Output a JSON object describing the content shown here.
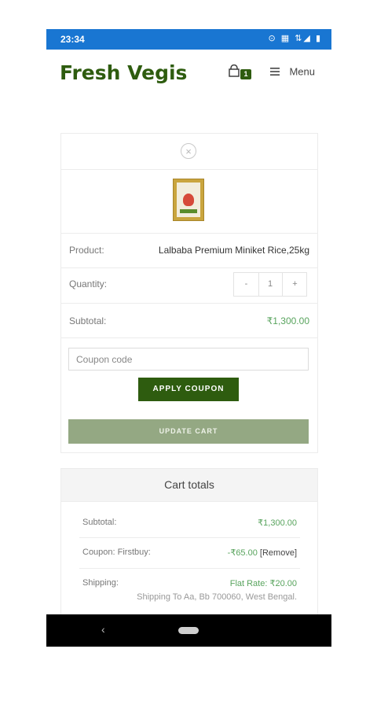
{
  "status_bar": {
    "time": "23:34",
    "icons": "⊙ ▦ ⇅◢ ▮"
  },
  "header": {
    "brand": "Fresh Vegis",
    "cart_count": "1",
    "menu_label": "Menu"
  },
  "cart": {
    "remove_icon": "×",
    "product_label": "Product:",
    "product_name": "Lalbaba Premium Miniket Rice,25kg",
    "quantity_label": "Quantity:",
    "quantity_minus": "-",
    "quantity_value": "1",
    "quantity_plus": "+",
    "subtotal_label": "Subtotal:",
    "subtotal_value": "₹1,300.00",
    "coupon_placeholder": "Coupon code",
    "apply_coupon_label": "APPLY COUPON",
    "update_cart_label": "UPDATE CART"
  },
  "totals": {
    "title": "Cart totals",
    "subtotal_label": "Subtotal:",
    "subtotal_value": "₹1,300.00",
    "coupon_label": "Coupon: Firstbuy:",
    "coupon_value": "-₹65.00",
    "coupon_remove": "[Remove]",
    "shipping_label": "Shipping:",
    "shipping_value": "Flat Rate: ₹20.00",
    "shipping_destination": "Shipping To Aa, Bb 700060, West Bengal."
  },
  "nav": {
    "back_glyph": "‹"
  },
  "colors": {
    "status_bar": "#1976d2",
    "brand": "#2e5c0f",
    "price": "#59a45e",
    "update_button": "#94a883"
  }
}
